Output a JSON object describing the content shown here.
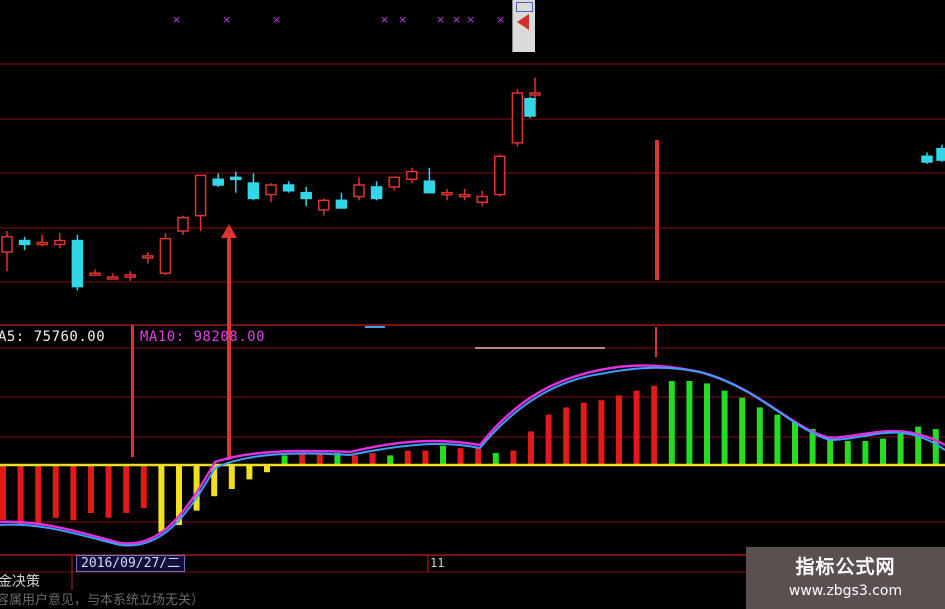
{
  "legend": {
    "ma5": "A5: 75760.00",
    "ma10": "MA10: 98208.00"
  },
  "footer": {
    "date": "2016/09/27/二",
    "marker": "11",
    "indicator_name": "金决策",
    "disclaimer": "容属用户意见，与本系统立场无关）"
  },
  "watermark": {
    "title": "指标公式网",
    "url": "www.zbgs3.com"
  },
  "colors": {
    "up": "#e03232",
    "down": "#33d6e6",
    "macd_up": "#e01a1a",
    "macd_up_late": "#22dd22",
    "macd_down": "#f0e020",
    "zero_line": "#f0e020",
    "line_fast": "#e030e0",
    "line_slow": "#3aa0ff",
    "grid": "#8a1010",
    "signal": "#e03232"
  },
  "chart_data": {
    "type": "candlestick",
    "candles": [
      {
        "o": 0.5,
        "h": 1.6,
        "l": -0.5,
        "c": 1.3
      },
      {
        "o": 1.1,
        "h": 1.3,
        "l": 0.6,
        "c": 0.9
      },
      {
        "o": 1.0,
        "h": 1.4,
        "l": 0.8,
        "c": 1.0
      },
      {
        "o": 0.9,
        "h": 1.5,
        "l": 0.7,
        "c": 1.1
      },
      {
        "o": 1.1,
        "h": 1.4,
        "l": -1.5,
        "c": -1.3
      },
      {
        "o": -0.6,
        "h": -0.4,
        "l": -0.7,
        "c": -0.6
      },
      {
        "o": -0.8,
        "h": -0.6,
        "l": -0.9,
        "c": -0.8
      },
      {
        "o": -0.8,
        "h": -0.5,
        "l": -1.0,
        "c": -0.7
      },
      {
        "o": 0.3,
        "h": 0.5,
        "l": -0.1,
        "c": 0.3
      },
      {
        "o": -0.6,
        "h": 1.5,
        "l": -0.7,
        "c": 1.2
      },
      {
        "o": 1.6,
        "h": 2.4,
        "l": 1.4,
        "c": 2.3
      },
      {
        "o": 2.4,
        "h": 4.4,
        "l": 1.6,
        "c": 4.5
      },
      {
        "o": 4.3,
        "h": 4.6,
        "l": 3.9,
        "c": 4.0
      },
      {
        "o": 4.4,
        "h": 4.7,
        "l": 3.6,
        "c": 4.3
      },
      {
        "o": 4.1,
        "h": 4.6,
        "l": 3.2,
        "c": 3.3
      },
      {
        "o": 3.5,
        "h": 4.1,
        "l": 3.1,
        "c": 4.0
      },
      {
        "o": 4.0,
        "h": 4.2,
        "l": 3.6,
        "c": 3.7
      },
      {
        "o": 3.6,
        "h": 3.9,
        "l": 2.9,
        "c": 3.3
      },
      {
        "o": 2.7,
        "h": 3.3,
        "l": 2.4,
        "c": 3.2
      },
      {
        "o": 3.2,
        "h": 3.6,
        "l": 2.8,
        "c": 2.8
      },
      {
        "o": 3.4,
        "h": 4.4,
        "l": 3.2,
        "c": 4.0
      },
      {
        "o": 3.9,
        "h": 4.2,
        "l": 3.2,
        "c": 3.3
      },
      {
        "o": 3.9,
        "h": 4.4,
        "l": 3.7,
        "c": 4.4
      },
      {
        "o": 4.3,
        "h": 4.9,
        "l": 4.1,
        "c": 4.7
      },
      {
        "o": 4.2,
        "h": 4.9,
        "l": 3.6,
        "c": 3.6
      },
      {
        "o": 3.6,
        "h": 3.8,
        "l": 3.2,
        "c": 3.6
      },
      {
        "o": 3.5,
        "h": 3.8,
        "l": 3.2,
        "c": 3.5
      },
      {
        "o": 3.1,
        "h": 3.7,
        "l": 2.9,
        "c": 3.4
      },
      {
        "o": 3.5,
        "h": 5.6,
        "l": 3.4,
        "c": 5.5
      },
      {
        "o": 6.2,
        "h": 9.0,
        "l": 6.0,
        "c": 8.8
      },
      {
        "o": 8.8,
        "h": 9.6,
        "l": 8.2,
        "c": 8.8
      },
      {
        "o": 8.5,
        "h": 8.6,
        "l": 7.5,
        "c": 7.6
      },
      {
        "o": 5.5,
        "h": 5.7,
        "l": 5.1,
        "c": 5.2
      },
      {
        "o": 5.9,
        "h": 6.1,
        "l": 5.2,
        "c": 5.3
      }
    ],
    "macd_hist": [
      -2.3,
      -2.5,
      -2.5,
      -2.2,
      -2.3,
      -2.0,
      -2.2,
      -2.0,
      -1.8,
      -2.8,
      -2.5,
      -1.9,
      -1.3,
      -1.0,
      -0.6,
      -0.3,
      0.4,
      0.5,
      0.5,
      0.5,
      0.4,
      0.5,
      0.4,
      0.6,
      0.6,
      0.8,
      0.7,
      0.7,
      0.5,
      0.6,
      1.4,
      2.1,
      2.4,
      2.6,
      2.7,
      2.9,
      3.1,
      3.3,
      3.5,
      3.5,
      3.4,
      3.1,
      2.8,
      2.4,
      2.1,
      1.8,
      1.5,
      1.2,
      1.0,
      1.0,
      1.1,
      1.3,
      1.6,
      1.5,
      1.2,
      0.5
    ],
    "signal_markers": [
      {
        "index": 4,
        "label": "buy"
      },
      {
        "index": 11,
        "label": "buy"
      }
    ],
    "title": "",
    "xlabel": "",
    "ylabel": ""
  }
}
